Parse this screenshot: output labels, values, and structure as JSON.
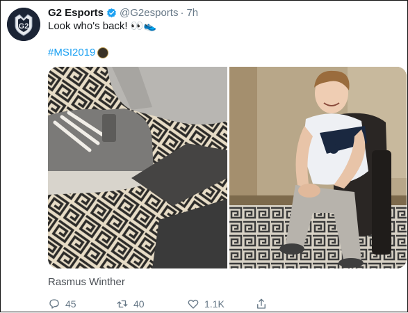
{
  "tweet": {
    "display_name": "G2 Esports",
    "handle": "@G2esports",
    "separator": "·",
    "time": "7h",
    "text": "Look who's back! 👀👟",
    "hashtag": "#MSI2019",
    "image_caption": "Rasmus Winther"
  },
  "actions": {
    "reply_count": "45",
    "retweet_count": "40",
    "like_count": "1.1K"
  },
  "colors": {
    "link": "#1da1f2",
    "verified": "#1da1f2",
    "muted": "#657786"
  },
  "icons": [
    "verified-badge-icon",
    "msi-badge-icon",
    "reply-icon",
    "retweet-icon",
    "like-icon",
    "share-icon"
  ]
}
